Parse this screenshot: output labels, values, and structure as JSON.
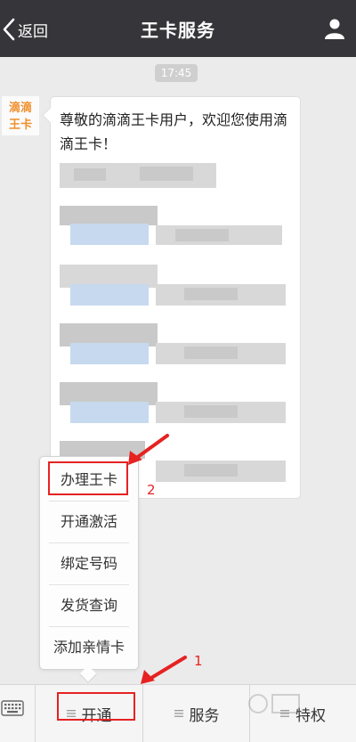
{
  "header": {
    "back_label": "返回",
    "title": "王卡服务"
  },
  "chat": {
    "time": "17:45",
    "avatar_line1": "滴滴",
    "avatar_line2": "王卡",
    "greeting": "尊敬的滴滴王卡用户，欢迎您使用滴滴王卡！"
  },
  "popup_menu": {
    "items": [
      "办理王卡",
      "开通激活",
      "绑定号码",
      "发货查询",
      "添加亲情卡"
    ]
  },
  "bottom_bar": {
    "tabs": [
      "开通",
      "服务",
      "特权"
    ]
  },
  "annotations": {
    "step1": "1",
    "step2": "2"
  },
  "colors": {
    "header_bg": "#35353a",
    "annotation_red": "#e62222",
    "avatar_orange": "#f0902e"
  }
}
